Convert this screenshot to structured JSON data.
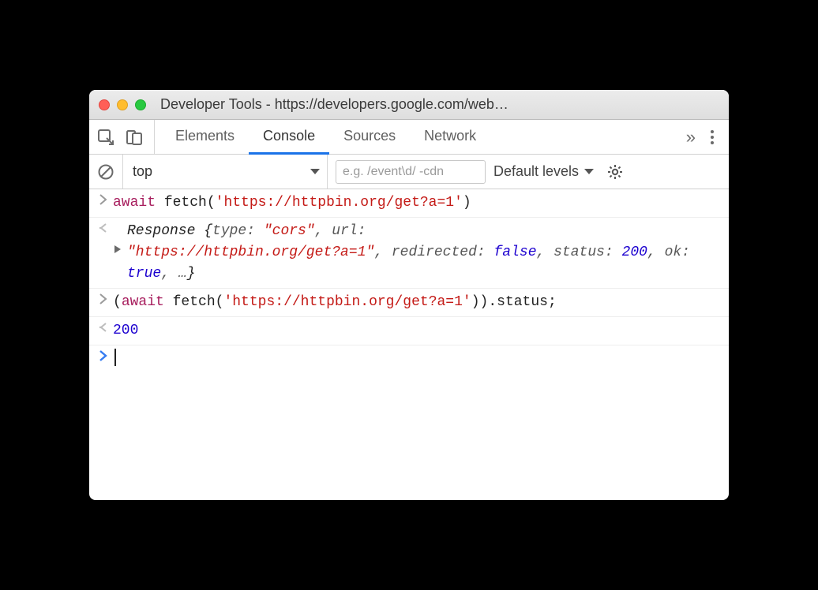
{
  "window": {
    "title": "Developer Tools - https://developers.google.com/web…"
  },
  "tabs": {
    "elements": "Elements",
    "console": "Console",
    "sources": "Sources",
    "network": "Network",
    "more": "»"
  },
  "filter": {
    "context": "top",
    "placeholder": "e.g. /event\\d/ -cdn",
    "levels": "Default levels"
  },
  "console": {
    "line1": {
      "await": "await",
      "fn": " fetch(",
      "str": "'https://httpbin.org/get?a=1'",
      "close": ")"
    },
    "line2": {
      "cls": "Response ",
      "open": "{",
      "p1k": "type: ",
      "p1v": "\"cors\"",
      "c1": ", ",
      "p2k": "url: ",
      "p2v": "\"https://httpbin.org/get?a=1\"",
      "c2": ", ",
      "p3k": "redirected: ",
      "p3v": "false",
      "c3": ", ",
      "p4k": "status: ",
      "p4v": "200",
      "c4": ", ",
      "p5k": "ok: ",
      "p5v": "true",
      "c5": ", ",
      "ell": "…",
      "close": "}"
    },
    "line3": {
      "open": "(",
      "await": "await",
      "fn": " fetch(",
      "str": "'https://httpbin.org/get?a=1'",
      "close1": ")",
      "close2": ")",
      "tail": ".status;"
    },
    "line4": {
      "val": "200"
    }
  }
}
